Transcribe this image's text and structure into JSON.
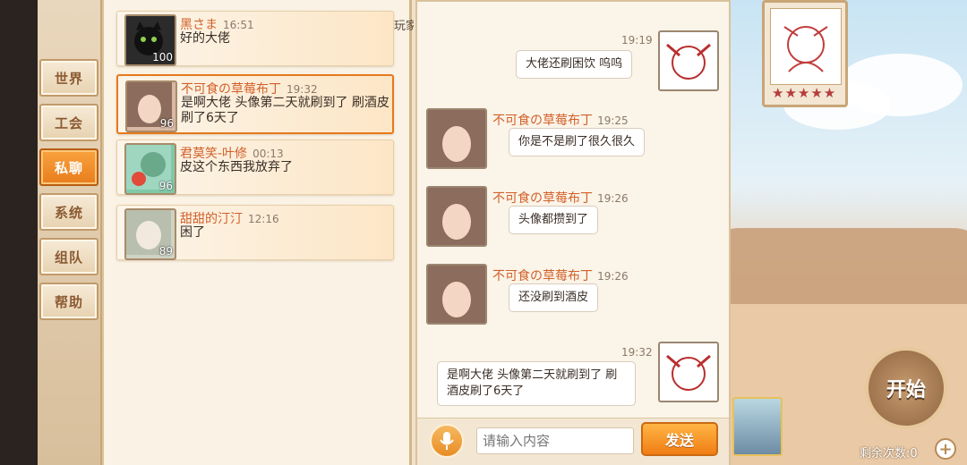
{
  "tabs": [
    {
      "label": "世界"
    },
    {
      "label": "工会"
    },
    {
      "label": "私聊"
    },
    {
      "label": "系统"
    },
    {
      "label": "组队"
    },
    {
      "label": "帮助"
    }
  ],
  "contacts": [
    {
      "name": "黑さま",
      "time": "16:51",
      "message": "好的大佬",
      "level": "100"
    },
    {
      "name": "不可食の草莓布丁",
      "time": "19:32",
      "message": "是啊大佬 头像第二天就刷到了 刷酒皮刷了6天了",
      "level": "96"
    },
    {
      "name": "君莫笑-叶修",
      "time": "00:13",
      "message": "皮这个东西我放弃了",
      "level": "96"
    },
    {
      "name": "甜甜的汀汀",
      "time": "12:16",
      "message": "困了",
      "level": "89"
    }
  ],
  "behind_label": "玩家",
  "messages": [
    {
      "from": "self",
      "time": "19:19",
      "text": "大佬还刷困饮 呜呜"
    },
    {
      "from": "other",
      "sender": "不可食の草莓布丁",
      "time": "19:25",
      "text": "你是不是刷了很久很久"
    },
    {
      "from": "other",
      "sender": "不可食の草莓布丁",
      "time": "19:26",
      "text": "头像都攒到了"
    },
    {
      "from": "other",
      "sender": "不可食の草莓布丁",
      "time": "19:26",
      "text": "还没刷到酒皮"
    },
    {
      "from": "self",
      "time": "19:32",
      "text": "是啊大佬 头像第二天就刷到了 刷酒皮刷了6天了"
    }
  ],
  "input": {
    "placeholder": "请输入内容",
    "send_label": "发送"
  },
  "scene": {
    "start_label": "开始",
    "remaining_label": "剩余次数:0",
    "stars": "★★★★★",
    "plus": "+"
  }
}
